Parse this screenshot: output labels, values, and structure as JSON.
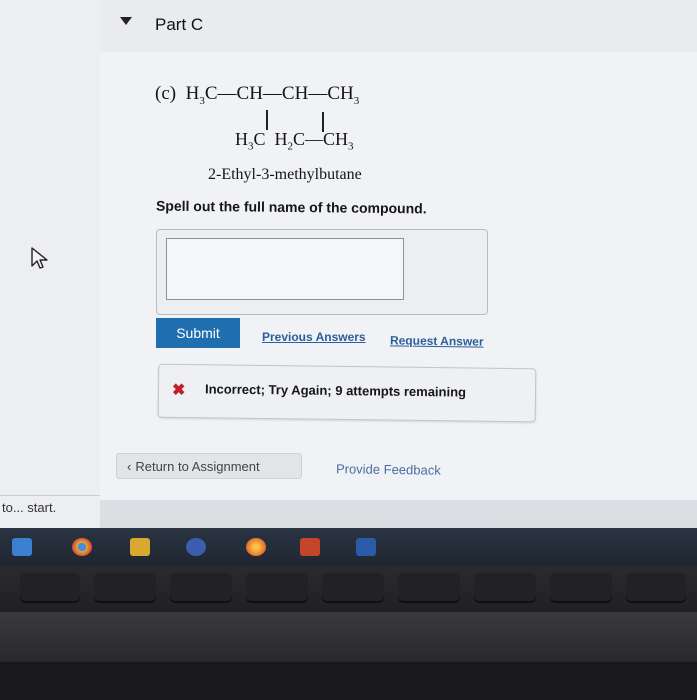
{
  "part": {
    "title": "Part C"
  },
  "question": {
    "label": "(c)",
    "formula_line1_parts": [
      "H",
      "3",
      "C",
      "CH",
      "CH",
      "CH",
      "3"
    ],
    "formula_line2_parts": [
      "H",
      "3",
      "C",
      "H",
      "2",
      "C",
      "CH",
      "3"
    ],
    "given_name": "2-Ethyl-3-methylbutane",
    "prompt": "Spell out the full name of the compound."
  },
  "answer": {
    "value": ""
  },
  "actions": {
    "submit_label": "Submit",
    "previous_answers_label": "Previous Answers",
    "request_answer_label": "Request Answer"
  },
  "feedback": {
    "icon": "x-icon",
    "strong_text": "Incorrect;",
    "rest_text": "Try Again; 9 attempts remaining",
    "color": "#c0202a"
  },
  "footer": {
    "return_label": "Return to Assignment",
    "provide_feedback_label": "Provide Feedback"
  },
  "sidebar": {
    "text": "to... start."
  },
  "taskbar": {
    "icons": [
      "mail-icon",
      "chrome-icon",
      "files-icon",
      "app-icon",
      "firefox-icon",
      "powerpoint-icon",
      "word-icon"
    ]
  },
  "colors": {
    "submit": "#1f6fb0",
    "link": "#2a5f9c",
    "error": "#c0202a"
  }
}
